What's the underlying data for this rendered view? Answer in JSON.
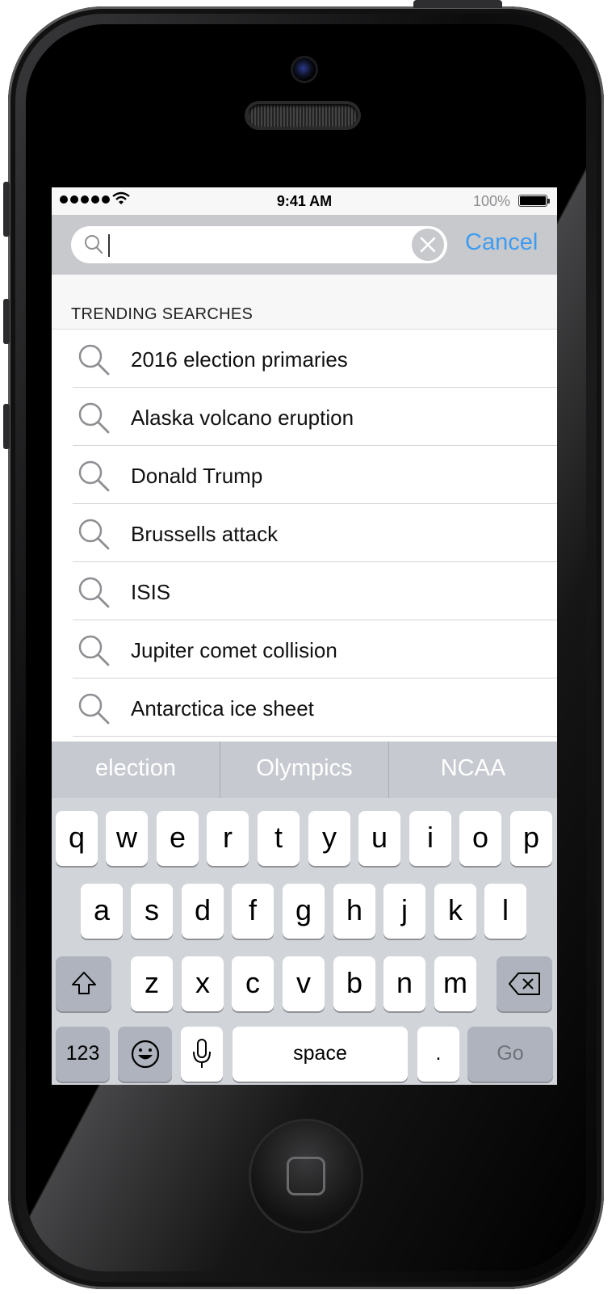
{
  "status_bar": {
    "time": "9:41 AM",
    "battery_text": "100%",
    "battery_level": 1.0,
    "signal_bars": 5
  },
  "search": {
    "value": "",
    "placeholder": "",
    "cancel_label": "Cancel",
    "icon": "search-icon",
    "clear_icon": "clear-icon"
  },
  "trending": {
    "header": "TRENDING SEARCHES",
    "items": [
      {
        "label": "2016 election primaries"
      },
      {
        "label": "Alaska volcano eruption"
      },
      {
        "label": "Donald Trump"
      },
      {
        "label": "Brussells attack"
      },
      {
        "label": "ISIS"
      },
      {
        "label": "Jupiter comet collision"
      },
      {
        "label": "Antarctica ice sheet"
      }
    ]
  },
  "keyboard": {
    "suggestions": [
      "election",
      "Olympics",
      "NCAA"
    ],
    "row1": [
      "q",
      "w",
      "e",
      "r",
      "t",
      "y",
      "u",
      "i",
      "o",
      "p"
    ],
    "row2": [
      "a",
      "s",
      "d",
      "f",
      "g",
      "h",
      "j",
      "k",
      "l"
    ],
    "row3": [
      "z",
      "x",
      "c",
      "v",
      "b",
      "n",
      "m"
    ],
    "numbers_label": "123",
    "space_label": "space",
    "period_label": ".",
    "go_label": "Go",
    "shift_icon": "shift-icon",
    "delete_icon": "backspace-icon",
    "emoji_icon": "emoji-icon",
    "mic_icon": "microphone-icon"
  },
  "colors": {
    "accent": "#3d9cf0",
    "keyboard_bg": "#d1d4d9",
    "suggestion_bg": "#c6c9d0",
    "search_bar_bg": "#c8c9cd"
  }
}
